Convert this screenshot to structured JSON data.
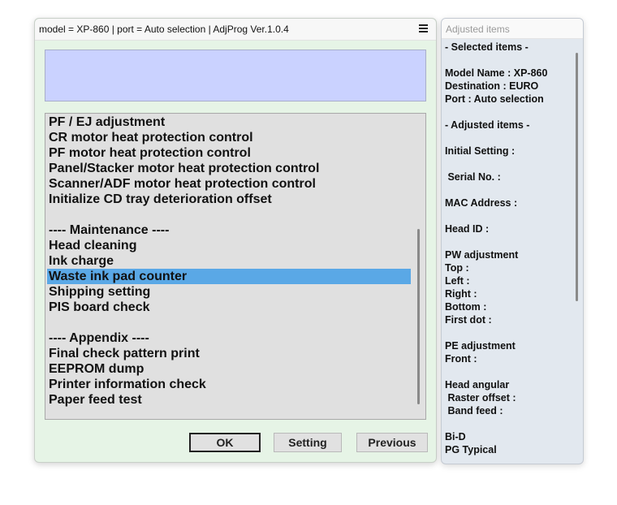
{
  "main_window": {
    "title": "model = XP-860 | port = Auto selection | AdjProg Ver.1.0.4",
    "icon": "hamburger-menu-icon",
    "list_items": [
      "PF / EJ adjustment",
      "CR motor heat protection control",
      "PF motor heat protection control",
      "Panel/Stacker motor heat protection control",
      "Scanner/ADF motor heat protection control",
      "Initialize CD tray deterioration offset",
      "",
      "---- Maintenance ----",
      "Head cleaning",
      "Ink charge",
      "Waste ink pad counter",
      "Shipping setting",
      "PIS board check",
      "",
      "---- Appendix ----",
      "Final check pattern print",
      "EEPROM dump",
      "Printer information check",
      "Paper feed test"
    ],
    "selected_item": "Waste ink pad counter",
    "buttons": {
      "ok": "OK",
      "setting": "Setting",
      "previous": "Previous"
    }
  },
  "side_window": {
    "title": "Adjusted items",
    "lines": [
      "- Selected items -",
      "",
      "Model Name : XP-860",
      "Destination : EURO",
      "Port : Auto selection",
      "",
      "- Adjusted items -",
      "",
      "Initial Setting :",
      "",
      " Serial No. :",
      "",
      "MAC Address :",
      "",
      "Head ID :",
      "",
      "PW adjustment",
      "Top :",
      "Left :",
      "Right :",
      "Bottom :",
      "First dot :",
      "",
      "PE adjustment",
      "Front :",
      "",
      "Head angular",
      " Raster offset :",
      " Band feed :",
      "",
      "Bi-D",
      "PG Typical"
    ]
  },
  "colors": {
    "main_bg": "#e6f4e6",
    "message_bg": "#cad2ff",
    "list_bg": "#e0e0e0",
    "selection": "#5aa8e6",
    "side_bg": "#e2e8ef"
  }
}
